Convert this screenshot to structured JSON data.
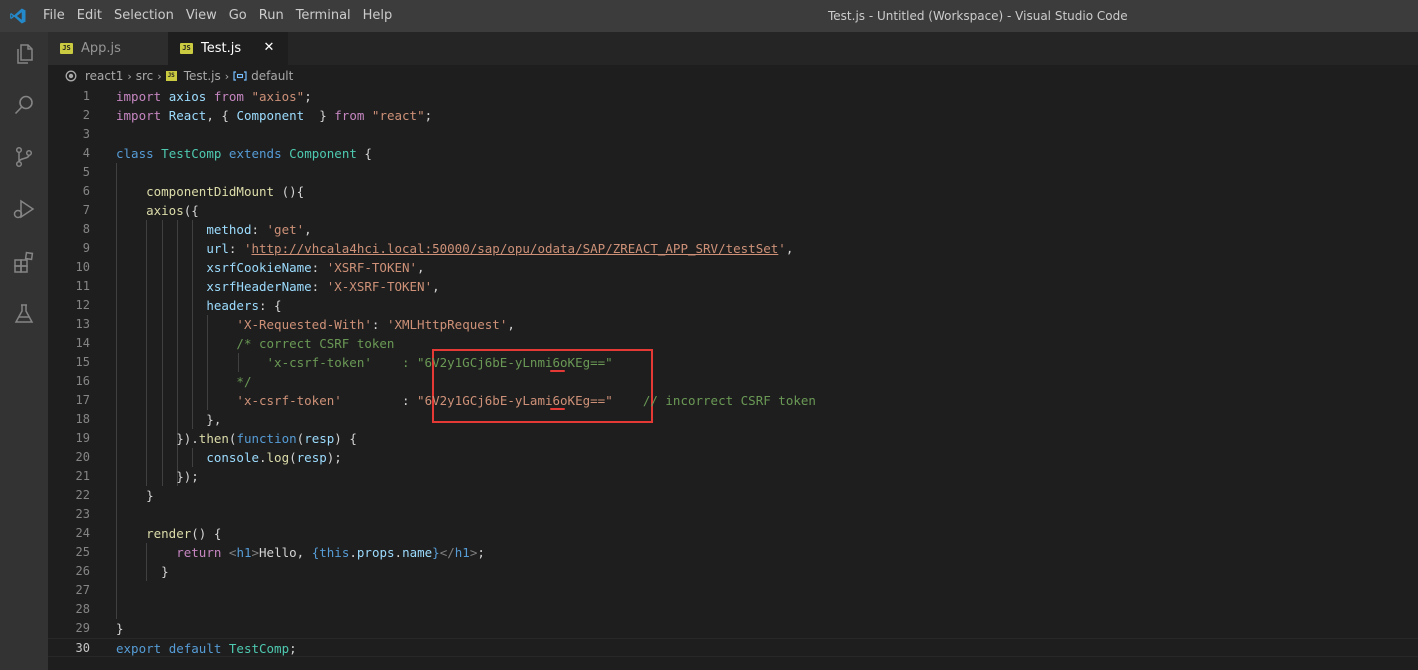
{
  "window": {
    "title": "Test.js - Untitled (Workspace) - Visual Studio Code",
    "menu": [
      "File",
      "Edit",
      "Selection",
      "View",
      "Go",
      "Run",
      "Terminal",
      "Help"
    ]
  },
  "activity_icons": [
    "explorer-icon",
    "search-icon",
    "source-control-icon",
    "run-debug-icon",
    "extensions-icon",
    "testing-icon"
  ],
  "tabs": [
    {
      "label": "App.js",
      "badge": "JS",
      "active": false
    },
    {
      "label": "Test.js",
      "badge": "JS",
      "active": true,
      "close": "✕"
    }
  ],
  "breadcrumb": {
    "folder": "react1",
    "sub": "src",
    "file": "Test.js",
    "symbol": "default",
    "separator": "›"
  },
  "colors": {
    "keyword": "#569cd6",
    "control": "#c586c0",
    "variable": "#9cdcfe",
    "class": "#4ec9b0",
    "function": "#dcdcaa",
    "string": "#ce9178",
    "comment": "#6a9955",
    "highlight": "#e53935"
  },
  "lines": [
    {
      "n": "1",
      "guides": [],
      "tokens": [
        [
          "kc",
          "import"
        ],
        [
          "p",
          " "
        ],
        [
          "id",
          "axios"
        ],
        [
          "p",
          " "
        ],
        [
          "kc",
          "from"
        ],
        [
          "p",
          " "
        ],
        [
          "str",
          "\"axios\""
        ],
        [
          "p",
          ";"
        ]
      ]
    },
    {
      "n": "2",
      "guides": [],
      "tokens": [
        [
          "kc",
          "import"
        ],
        [
          "p",
          " "
        ],
        [
          "id",
          "React"
        ],
        [
          "p",
          ", { "
        ],
        [
          "id",
          "Component"
        ],
        [
          "p",
          "  } "
        ],
        [
          "kc",
          "from"
        ],
        [
          "p",
          " "
        ],
        [
          "str",
          "\"react\""
        ],
        [
          "p",
          ";"
        ]
      ]
    },
    {
      "n": "3",
      "guides": [],
      "tokens": []
    },
    {
      "n": "4",
      "guides": [],
      "tokens": [
        [
          "kw",
          "class"
        ],
        [
          "p",
          " "
        ],
        [
          "cls",
          "TestComp"
        ],
        [
          "p",
          " "
        ],
        [
          "kw",
          "extends"
        ],
        [
          "p",
          " "
        ],
        [
          "cls",
          "Component"
        ],
        [
          "p",
          " {"
        ]
      ]
    },
    {
      "n": "5",
      "guides": [
        0
      ],
      "tokens": []
    },
    {
      "n": "6",
      "guides": [
        0
      ],
      "tokens": [
        [
          "p",
          "    "
        ],
        [
          "fn",
          "componentDidMount"
        ],
        [
          "p",
          " (){"
        ]
      ]
    },
    {
      "n": "7",
      "guides": [
        0
      ],
      "tokens": [
        [
          "p",
          "    "
        ],
        [
          "fn",
          "axios"
        ],
        [
          "p",
          "({"
        ]
      ]
    },
    {
      "n": "8",
      "guides": [
        0,
        4,
        6,
        8,
        10
      ],
      "tokens": [
        [
          "p",
          "            "
        ],
        [
          "id",
          "method"
        ],
        [
          "p",
          ": "
        ],
        [
          "str",
          "'get'"
        ],
        [
          "p",
          ","
        ]
      ]
    },
    {
      "n": "9",
      "guides": [
        0,
        4,
        6,
        8,
        10
      ],
      "tokens": [
        [
          "p",
          "            "
        ],
        [
          "id",
          "url"
        ],
        [
          "p",
          ": "
        ],
        [
          "str",
          "'"
        ],
        [
          "url",
          "http://vhcala4hci.local:50000/sap/opu/odata/SAP/ZREACT_APP_SRV/testSet"
        ],
        [
          "str",
          "'"
        ],
        [
          "p",
          ","
        ]
      ]
    },
    {
      "n": "10",
      "guides": [
        0,
        4,
        6,
        8,
        10
      ],
      "tokens": [
        [
          "p",
          "            "
        ],
        [
          "id",
          "xsrfCookieName"
        ],
        [
          "p",
          ": "
        ],
        [
          "str",
          "'XSRF-TOKEN'"
        ],
        [
          "p",
          ","
        ]
      ]
    },
    {
      "n": "11",
      "guides": [
        0,
        4,
        6,
        8,
        10
      ],
      "tokens": [
        [
          "p",
          "            "
        ],
        [
          "id",
          "xsrfHeaderName"
        ],
        [
          "p",
          ": "
        ],
        [
          "str",
          "'X-XSRF-TOKEN'"
        ],
        [
          "p",
          ","
        ]
      ]
    },
    {
      "n": "12",
      "guides": [
        0,
        4,
        6,
        8,
        10
      ],
      "tokens": [
        [
          "p",
          "            "
        ],
        [
          "id",
          "headers"
        ],
        [
          "p",
          ": {"
        ]
      ]
    },
    {
      "n": "13",
      "guides": [
        0,
        4,
        6,
        8,
        10,
        12
      ],
      "tokens": [
        [
          "p",
          "                "
        ],
        [
          "str",
          "'X-Requested-With'"
        ],
        [
          "p",
          ": "
        ],
        [
          "str",
          "'XMLHttpRequest'"
        ],
        [
          "p",
          ","
        ]
      ]
    },
    {
      "n": "14",
      "guides": [
        0,
        4,
        6,
        8,
        10,
        12
      ],
      "tokens": [
        [
          "p",
          "                "
        ],
        [
          "cm",
          "/* correct CSRF token"
        ]
      ]
    },
    {
      "n": "15",
      "guides": [
        0,
        4,
        6,
        8,
        10,
        12,
        16
      ],
      "tokens": [
        [
          "p",
          "                    "
        ],
        [
          "cm",
          "'x-csrf-token'    : \"6V2y1GCj6bE-yLnmi6oKEg==\""
        ]
      ]
    },
    {
      "n": "16",
      "guides": [
        0,
        4,
        6,
        8,
        10,
        12
      ],
      "tokens": [
        [
          "p",
          "                "
        ],
        [
          "cm",
          "*/"
        ]
      ]
    },
    {
      "n": "17",
      "guides": [
        0,
        4,
        6,
        8,
        10,
        12
      ],
      "tokens": [
        [
          "p",
          "                "
        ],
        [
          "str",
          "'x-csrf-token'"
        ],
        [
          "p",
          "        : "
        ],
        [
          "str",
          "\"6V2y1GCj6bE-yLami6oKEg==\""
        ],
        [
          "p",
          "    "
        ],
        [
          "cm",
          "// incorrect CSRF token"
        ]
      ]
    },
    {
      "n": "18",
      "guides": [
        0,
        4,
        6,
        8,
        10
      ],
      "tokens": [
        [
          "p",
          "            },"
        ]
      ]
    },
    {
      "n": "19",
      "guides": [
        0,
        4,
        6,
        8
      ],
      "tokens": [
        [
          "p",
          "        })."
        ],
        [
          "fn",
          "then"
        ],
        [
          "p",
          "("
        ],
        [
          "kw",
          "function"
        ],
        [
          "p",
          "("
        ],
        [
          "id",
          "resp"
        ],
        [
          "p",
          ") {"
        ]
      ]
    },
    {
      "n": "20",
      "guides": [
        0,
        4,
        6,
        8,
        10
      ],
      "tokens": [
        [
          "p",
          "            "
        ],
        [
          "id",
          "console"
        ],
        [
          "p",
          "."
        ],
        [
          "fn",
          "log"
        ],
        [
          "p",
          "("
        ],
        [
          "id",
          "resp"
        ],
        [
          "p",
          ");"
        ]
      ]
    },
    {
      "n": "21",
      "guides": [
        0,
        4,
        6,
        8
      ],
      "tokens": [
        [
          "p",
          "        });"
        ]
      ]
    },
    {
      "n": "22",
      "guides": [
        0
      ],
      "tokens": [
        [
          "p",
          "    }"
        ]
      ]
    },
    {
      "n": "23",
      "guides": [
        0
      ],
      "tokens": []
    },
    {
      "n": "24",
      "guides": [
        0
      ],
      "tokens": [
        [
          "p",
          "    "
        ],
        [
          "fn",
          "render"
        ],
        [
          "p",
          "() {"
        ]
      ]
    },
    {
      "n": "25",
      "guides": [
        0,
        4
      ],
      "tokens": [
        [
          "p",
          "        "
        ],
        [
          "kc",
          "return"
        ],
        [
          "p",
          " "
        ],
        [
          "tag",
          "<"
        ],
        [
          "tagn",
          "h1"
        ],
        [
          "tag",
          ">"
        ],
        [
          "p",
          "Hello, "
        ],
        [
          "kw",
          "{this"
        ],
        [
          "p",
          "."
        ],
        [
          "id",
          "props"
        ],
        [
          "p",
          "."
        ],
        [
          "id",
          "name"
        ],
        [
          "kw",
          "}"
        ],
        [
          "tag",
          "</"
        ],
        [
          "tagn",
          "h1"
        ],
        [
          "tag",
          ">"
        ],
        [
          "p",
          ";"
        ]
      ]
    },
    {
      "n": "26",
      "guides": [
        0,
        4
      ],
      "tokens": [
        [
          "p",
          "      }"
        ]
      ]
    },
    {
      "n": "27",
      "guides": [
        0
      ],
      "tokens": []
    },
    {
      "n": "28",
      "guides": [
        0
      ],
      "tokens": []
    },
    {
      "n": "29",
      "guides": [],
      "tokens": [
        [
          "p",
          "}"
        ]
      ]
    },
    {
      "n": "30",
      "guides": [],
      "current": true,
      "tokens": [
        [
          "kw",
          "export"
        ],
        [
          "p",
          " "
        ],
        [
          "kw",
          "default"
        ],
        [
          "p",
          " "
        ],
        [
          "cls",
          "TestComp"
        ],
        [
          "p",
          ";"
        ]
      ]
    }
  ]
}
